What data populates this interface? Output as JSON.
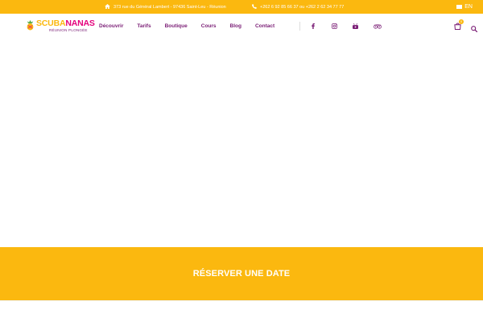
{
  "topbar": {
    "address": "373 rue du Général Lambert - 97436 Saint-Leu - Réunion",
    "phone": "+262 6 92 85 66 37 ou +262 2 62 34 77 77",
    "language": "EN"
  },
  "logo": {
    "word_a": "SCUBA",
    "word_b": "NANAS",
    "tagline": "RÉUNION PLONGÉE"
  },
  "nav": {
    "items": [
      {
        "label": "Découvrir"
      },
      {
        "label": "Tarifs"
      },
      {
        "label": "Boutique"
      },
      {
        "label": "Cours"
      },
      {
        "label": "Blog"
      },
      {
        "label": "Contact"
      }
    ]
  },
  "social": [
    "facebook-icon",
    "instagram-icon",
    "youtube-icon",
    "tripadvisor-icon"
  ],
  "cart": {
    "count": "0"
  },
  "cta": {
    "label": "RÉSERVER UNE DATE"
  },
  "colors": {
    "accent": "#fbb80f",
    "brand_purple": "#7a1d75",
    "brand_pink": "#e4007c"
  }
}
